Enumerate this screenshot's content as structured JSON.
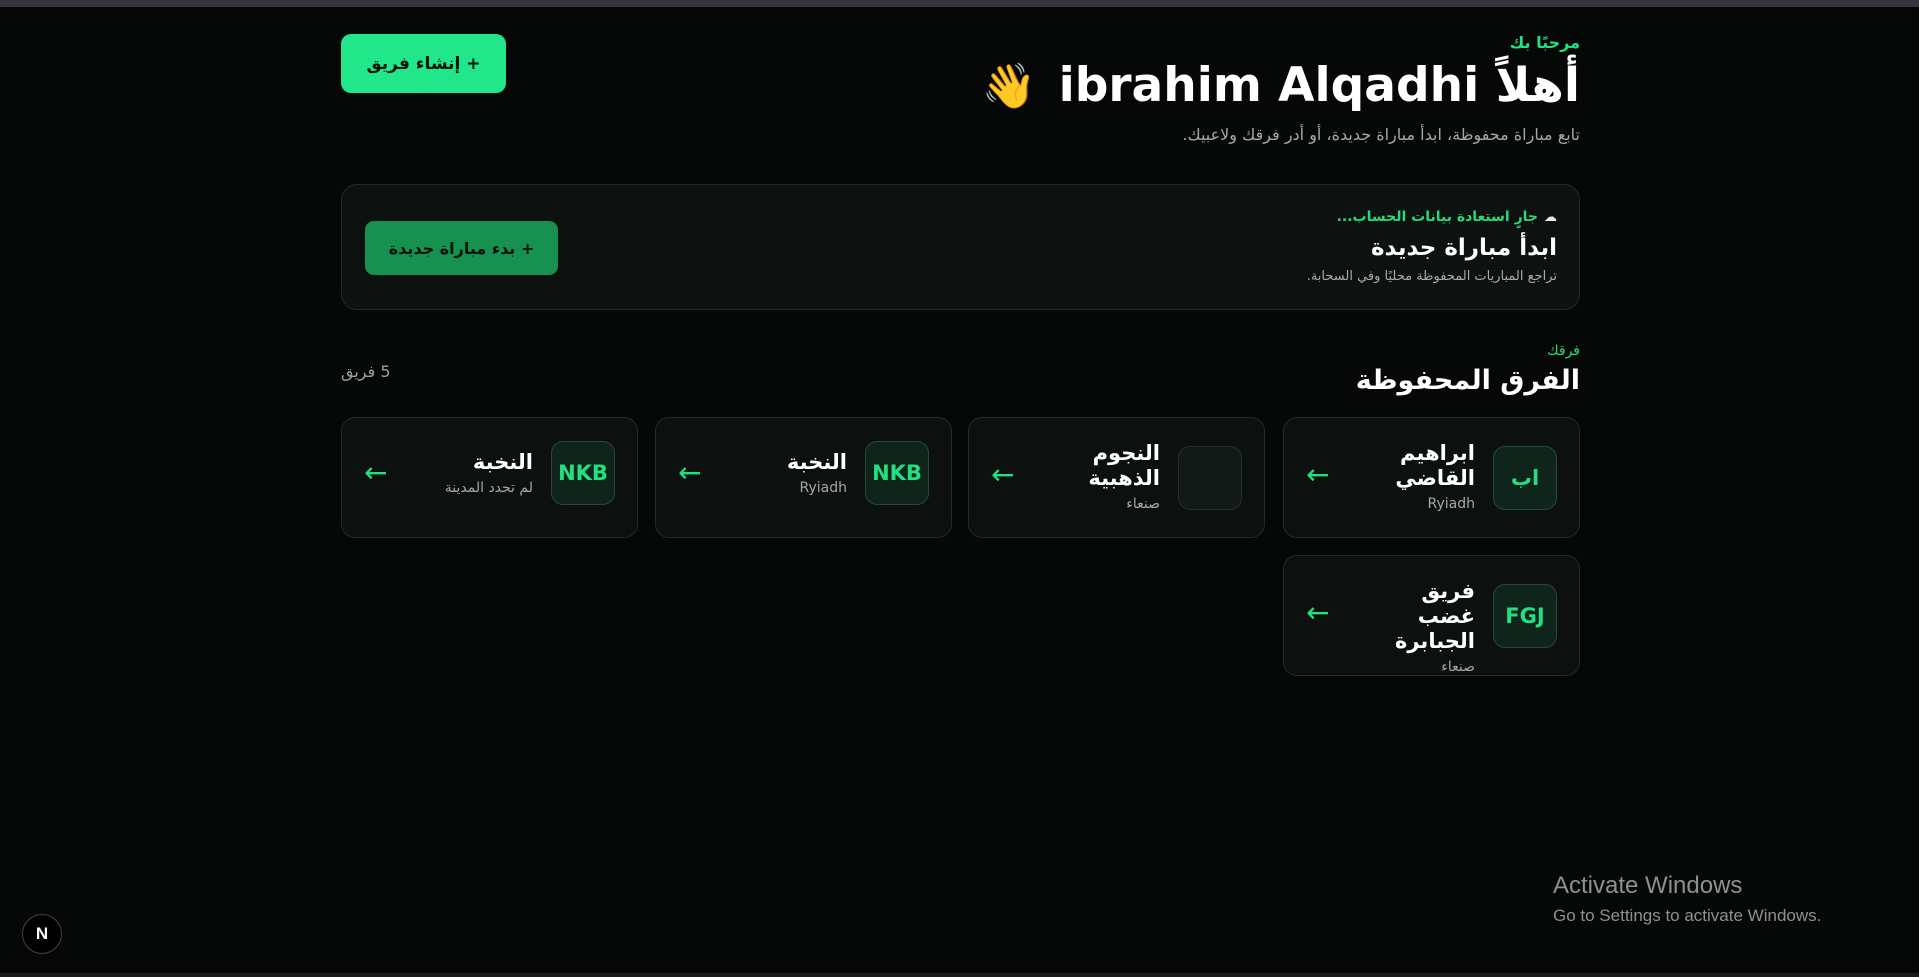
{
  "header": {
    "eyebrow": "مرحبًا بك",
    "greeting": "أهلاً ibrahim Alqadhi",
    "wave_emoji": "👋",
    "subtitle": "تابع مباراة محفوظة، ابدأ مباراة جديدة، أو أدر فرقك ولاعبيك.",
    "create_team_label": "+ إنشاء فريق"
  },
  "match": {
    "restore_status": "جارٍ استعادة بيانات الحساب...",
    "cloud_icon": "☁",
    "title": "ابدأ مباراة جديدة",
    "subtitle": "تراجع المباريات المحفوظة محليًا وفي السحابة.",
    "start_label": "+ بدء مباراة جديدة"
  },
  "teams": {
    "eyebrow": "فرقك",
    "title": "الفرق المحفوظة",
    "count": "5 فريق",
    "items": [
      {
        "badge": "اب",
        "name": "ابراهيم القاضي",
        "city": "Ryiadh",
        "arrow": "←"
      },
      {
        "badge": "",
        "name": "النجوم الذهبية",
        "city": "صنعاء",
        "arrow": "←"
      },
      {
        "badge": "NKB",
        "name": "النخبة",
        "city": "Ryiadh",
        "arrow": "←"
      },
      {
        "badge": "NKB",
        "name": "النخبة",
        "city": "لم تحدد المدينة",
        "arrow": "←"
      },
      {
        "badge": "FGJ",
        "name": "فريق غضب الجبابرة",
        "city": "صنعاء",
        "arrow": "←"
      }
    ]
  },
  "watermark": {
    "title": "Activate Windows",
    "subtitle": "Go to Settings to activate Windows."
  },
  "dev_badge": "N",
  "colors": {
    "background": "#060807",
    "accent": "#22e68a",
    "accent_dark": "#16914f",
    "card": "#0d1210"
  }
}
